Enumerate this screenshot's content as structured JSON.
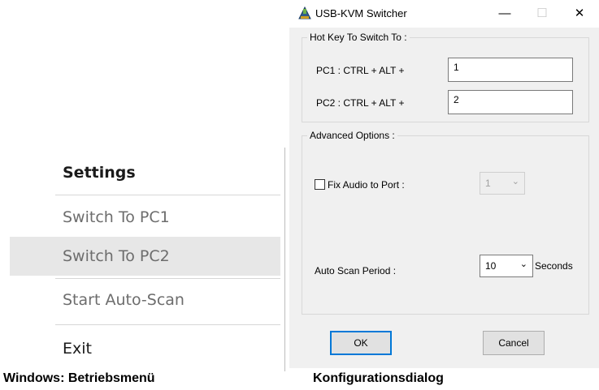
{
  "context_menu": {
    "title": "Settings",
    "items": [
      {
        "label": "Switch To PC1"
      },
      {
        "label": "Switch To PC2"
      },
      {
        "label": "Start Auto-Scan"
      },
      {
        "label": "Exit"
      }
    ]
  },
  "dialog": {
    "title": "USB-KVM Switcher",
    "window_buttons": {
      "minimize": "—",
      "maximize": "☐",
      "close": "✕"
    },
    "hotkey_group": {
      "legend": "Hot Key To Switch To :",
      "pc1_label": "PC1 : CTRL + ALT +",
      "pc1_value": "1",
      "pc2_label": "PC2 : CTRL + ALT +",
      "pc2_value": "2"
    },
    "advanced_group": {
      "legend": "Advanced Options :",
      "fix_audio_label": "Fix Audio to Port :",
      "fix_audio_checked": false,
      "audio_port_value": "1",
      "auto_scan_label": "Auto Scan Period :",
      "auto_scan_value": "10",
      "auto_scan_unit": "Seconds"
    },
    "ok_label": "OK",
    "cancel_label": "Cancel"
  },
  "captions": {
    "left": "Windows: Betriebsmenü",
    "right": "Konfigurationsdialog"
  },
  "colors": {
    "accent": "#0078d7",
    "menu_hover": "#e7e7e7",
    "dialog_bg": "#f0f0f0"
  },
  "icons": {
    "app": "usb-kvm-app-icon",
    "dropdown": "chevron-down-icon"
  }
}
